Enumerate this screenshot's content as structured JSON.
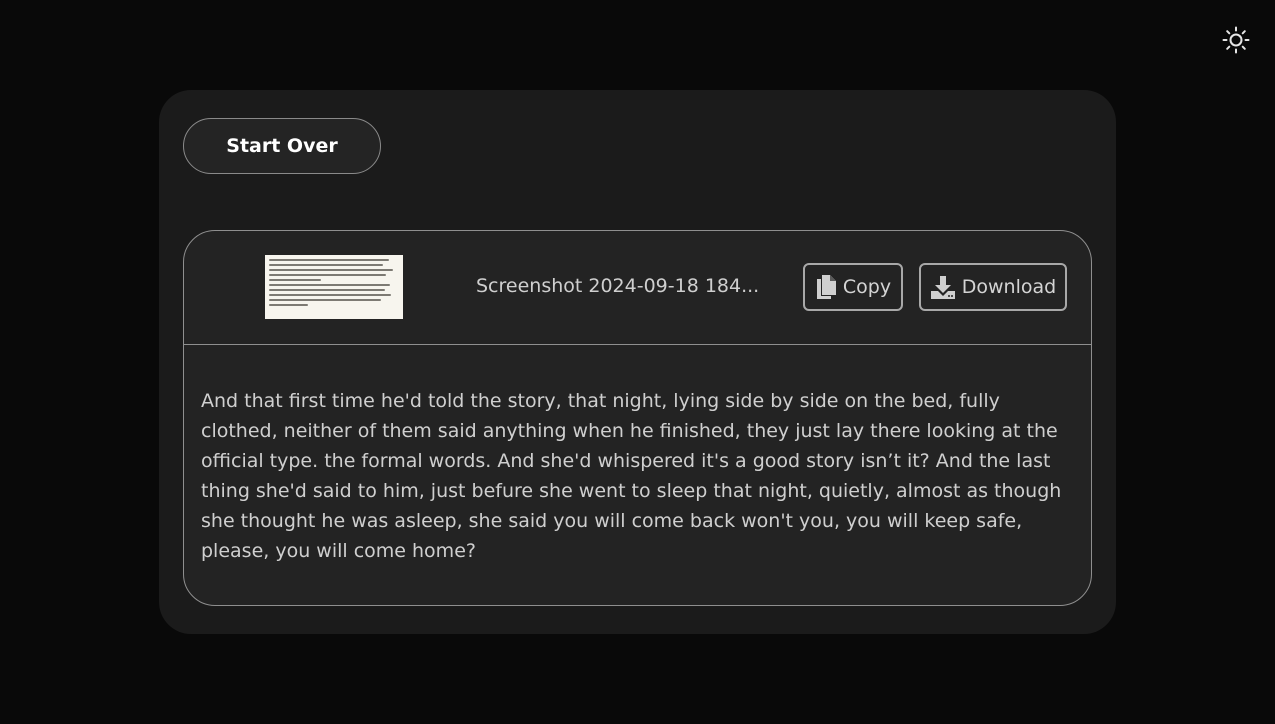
{
  "header": {
    "theme_toggle_icon": "sun-icon"
  },
  "panel": {
    "start_over_label": "Start Over"
  },
  "result": {
    "thumbnail_icon": "document-thumbnail",
    "filename": "Screenshot 2024-09-18 184...",
    "copy_label": "Copy",
    "copy_icon": "copy-icon",
    "download_label": "Download",
    "download_icon": "download-icon",
    "text": "And that first time he'd told the story, that night, lying side by side on the bed, fully clothed, neither of them said anything when he finished, they just lay there looking at the official type. the formal words. And she'd whispered it's a good story isn’t it? And the last thing she'd said to him, just befure she went to sleep that night, quietly, almost as though she thought he was asleep, she said you will come back won't you, you will keep safe, please, you will come home?"
  },
  "colors": {
    "background": "#090909",
    "panel": "#1b1b1b",
    "card": "#232323",
    "border": "#8f8f8f",
    "text": "#cfcfcf"
  }
}
